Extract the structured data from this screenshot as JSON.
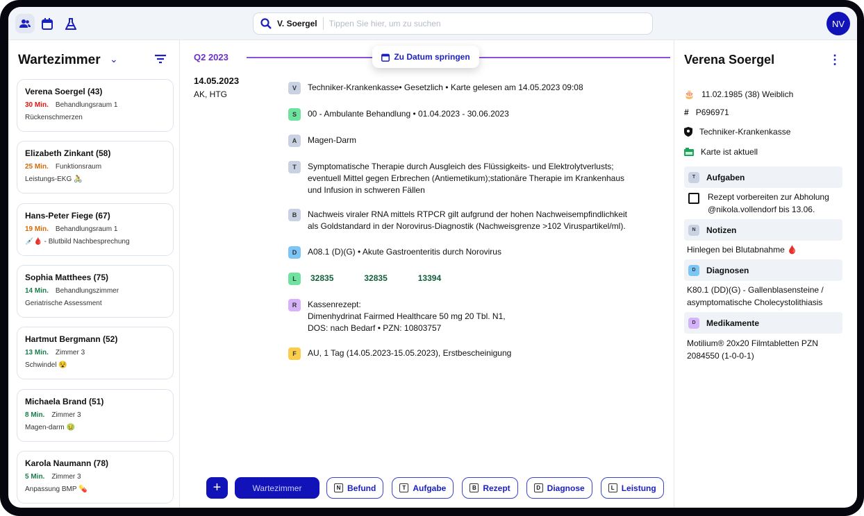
{
  "topbar": {
    "search_value": "V. Soergel",
    "search_placeholder": "Tippen Sie hier, um zu suchen",
    "avatar": "NV"
  },
  "waiting": {
    "title": "Wartezimmer",
    "patients": [
      {
        "name": "Verena Soergel  (43)",
        "time": "30 Min.",
        "time_color": "#e0140f",
        "room": "Behandlungsraum 1",
        "reason": "Rückenschmerzen"
      },
      {
        "name": "Elizabeth Zinkant  (58)",
        "time": "25 Min.",
        "time_color": "#d46a06",
        "room": "Funktionsraum",
        "reason": "Leistungs-EKG 🚴"
      },
      {
        "name": "Hans-Peter Fiege  (67)",
        "time": "19 Min.",
        "time_color": "#d46a06",
        "room": "Behandlungsraum 1",
        "reason": "💉🩸 - Blutbild Nachbesprechung"
      },
      {
        "name": "Sophia Matthees  (75)",
        "time": "14 Min.",
        "time_color": "#17804a",
        "room": "Behandlungszimmer",
        "reason": "Geriatrische Assessment"
      },
      {
        "name": "Hartmut Bergmann  (52)",
        "time": "13 Min.",
        "time_color": "#17804a",
        "room": "Zimmer 3",
        "reason": "Schwindel 😵"
      },
      {
        "name": "Michaela Brand  (51)",
        "time": "8 Min.",
        "time_color": "#17804a",
        "room": "Zimmer 3",
        "reason": "Magen-darm 🤢"
      },
      {
        "name": "Karola Naumann  (78)",
        "time": "5 Min.",
        "time_color": "#17804a",
        "room": "Zimmer 3",
        "reason": "Anpassung BMP 💊"
      }
    ]
  },
  "timeline": {
    "quarter": "Q2 2023",
    "jump_label": "Zu Datum springen",
    "date": "14.05.2023",
    "who": "AK, HTG",
    "entries": [
      {
        "badge": "V",
        "color": "#c9d2e2",
        "text": "Techniker-Krankenkasse• Gesetzlich • Karte gelesen am 14.05.2023 09:08"
      },
      {
        "badge": "S",
        "color": "#6ee29f",
        "text": "00 - Ambulante Behandlung • 01.04.2023 - 30.06.2023"
      },
      {
        "badge": "A",
        "color": "#c9d2e2",
        "text": "Magen-Darm"
      },
      {
        "badge": "T",
        "color": "#c9d2e2",
        "text": "Symptomatische Therapie durch Ausgleich des Flüssigkeits- und Elektrolytverlusts;\neventuell Mittel gegen Erbrechen (Antiemetikum);stationäre Therapie im Krankenhaus\nund Infusion in schweren Fällen"
      },
      {
        "badge": "B",
        "color": "#c9d2e2",
        "text": "Nachweis viraler RNA mittels RTPCR gilt aufgrund der hohen Nachweisempfindlichkeit\nals Goldstandard in der Norovirus-Diagnostik (Nachweisgrenze >102 Viruspartikel/ml)."
      },
      {
        "badge": "D",
        "color": "#7cc6f7",
        "text": "A08.1 (D)(G) • Akute Gastroenteritis durch Norovirus"
      },
      {
        "badge": "L",
        "color": "#6ee29f",
        "codes": [
          "32835",
          "32835",
          "13394"
        ]
      },
      {
        "badge": "R",
        "color": "#d5b2fa",
        "text": "Kassenrezept:\nDimenhydrinat Fairmed Healthcare 50 mg 20 Tbl. N1,\nDOS: nach Bedarf • PZN: 10803757"
      },
      {
        "badge": "F",
        "color": "#fbcd4a",
        "text": "AU, 1 Tag (14.05.2023-15.05.2023), Erstbescheinigung"
      }
    ]
  },
  "actions": {
    "waiting_room": "Wartezimmer",
    "buttons": [
      {
        "key": "N",
        "label": "Befund"
      },
      {
        "key": "T",
        "label": "Aufgabe"
      },
      {
        "key": "B",
        "label": "Rezept"
      },
      {
        "key": "D",
        "label": "Diagnose"
      },
      {
        "key": "L",
        "label": "Leistung"
      }
    ]
  },
  "patient": {
    "name": "Verena Soergel",
    "birth": "11.02.1985 (38) Weiblich",
    "id": "P696971",
    "insurance": "Techniker-Krankenkasse",
    "card": "Karte ist aktuell",
    "tasks_title": "Aufgaben",
    "task": "Rezept vorbereiten zur Abholung @nikola.vollendorf bis 13.06.",
    "notes_title": "Notizen",
    "note": "Hinlegen bei Blutabnahme 🩸",
    "diag_title": "Diagnosen",
    "diag": "K80.1 (DD)(G) - Gallenblasensteine / asymptomatische Cholecystolithiasis",
    "med_title": "Medikamente",
    "med": "Motilium® 20x20 Filmtabletten PZN 2084550 (1-0-0-1)"
  }
}
